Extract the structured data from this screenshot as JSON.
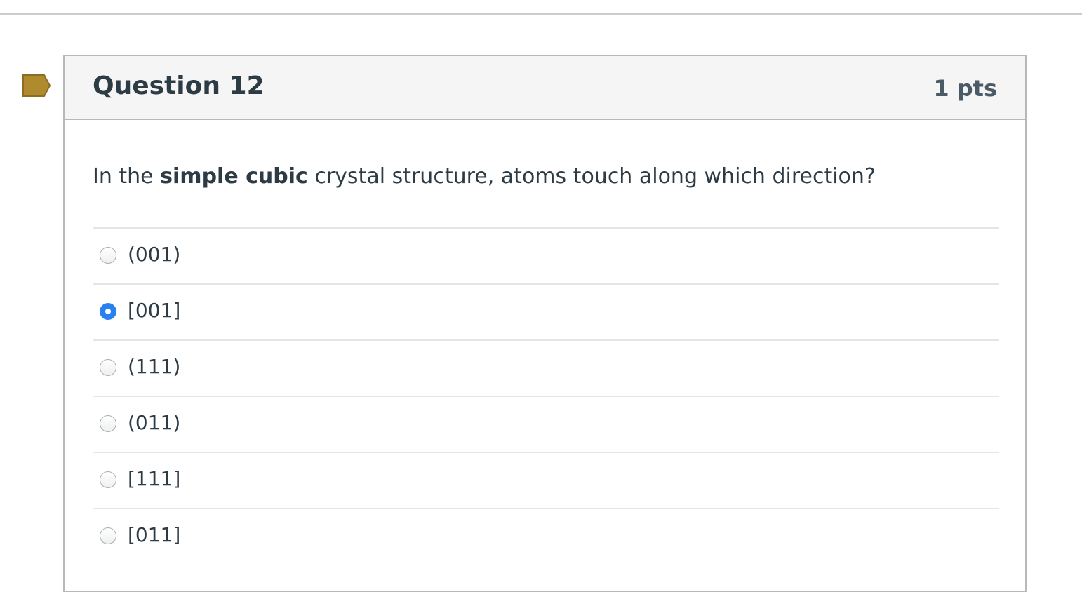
{
  "question": {
    "title": "Question 12",
    "points": "1 pts",
    "text_before": "In the ",
    "text_bold": "simple cubic",
    "text_after": " crystal structure, atoms touch along which direction?",
    "flag_color": "#b08a2e"
  },
  "answers": [
    {
      "label": "(001)",
      "selected": false
    },
    {
      "label": "[001]",
      "selected": true
    },
    {
      "label": "(111)",
      "selected": false
    },
    {
      "label": "(011)",
      "selected": false
    },
    {
      "label": "[111]",
      "selected": false
    },
    {
      "label": "[011]",
      "selected": false
    }
  ],
  "colors": {
    "selected_radio": "#2a80f0",
    "header_bg": "#f5f5f5",
    "text": "#2d3b45"
  }
}
